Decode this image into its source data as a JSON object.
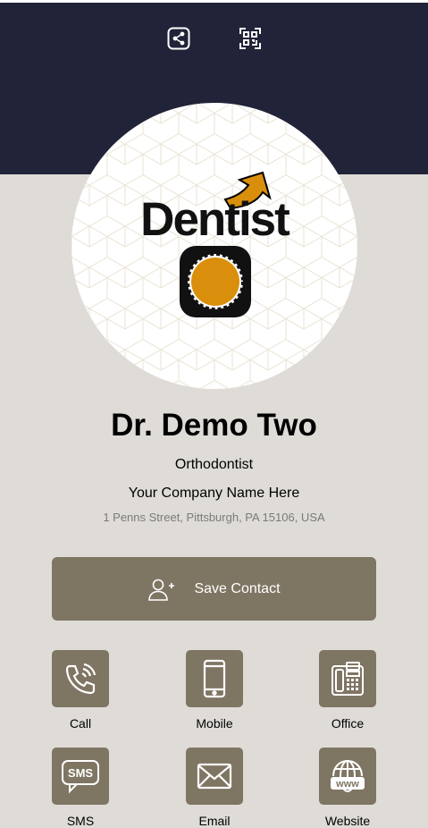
{
  "header": {
    "share_icon": "share-icon",
    "qr_icon": "qr-code-icon",
    "background_color": "#212338"
  },
  "profile": {
    "logo_text": "Dentist",
    "name": "Dr. Demo Two",
    "job_title": "Orthodontist",
    "company": "Your Company Name Here",
    "address": "1 Penns Street, Pittsburgh, PA 15106, USA"
  },
  "save_contact": {
    "label": "Save Contact",
    "icon": "add-user-icon"
  },
  "contact_actions": [
    {
      "label": "Call",
      "icon": "phone-icon"
    },
    {
      "label": "Mobile",
      "icon": "mobile-icon"
    },
    {
      "label": "Office",
      "icon": "office-phone-icon"
    },
    {
      "label": "SMS",
      "icon": "sms-icon",
      "icon_text": "SMS"
    },
    {
      "label": "Email",
      "icon": "email-icon"
    },
    {
      "label": "Website",
      "icon": "website-icon",
      "icon_text": "www"
    }
  ],
  "colors": {
    "accent": "#7f7563",
    "page_background": "#dfdcd8",
    "logo_orange": "#d98f0b"
  }
}
